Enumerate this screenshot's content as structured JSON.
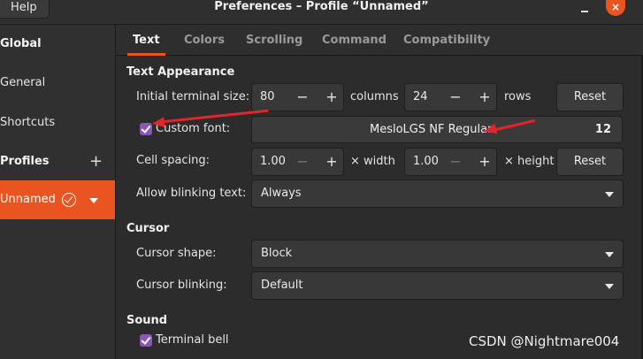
{
  "window": {
    "help_label": "Help",
    "title": "Preferences – Profile “Unnamed”",
    "close_glyph": "×"
  },
  "sidebar": {
    "global_heading": "Global",
    "items": [
      "General",
      "Shortcuts"
    ],
    "profiles_heading": "Profiles",
    "add_glyph": "+",
    "selected_profile": "Unnamed"
  },
  "tabs": [
    "Text",
    "Colors",
    "Scrolling",
    "Command",
    "Compatibility"
  ],
  "text_appearance": {
    "heading": "Text Appearance",
    "initial_size_label": "Initial terminal size:",
    "columns_value": "80",
    "columns_unit": "columns",
    "rows_value": "24",
    "rows_unit": "rows",
    "reset_label": "Reset",
    "custom_font_label": "Custom font:",
    "custom_font_checked": true,
    "font_name": "MesloLGS NF Regular",
    "font_size": "12",
    "cell_spacing_label": "Cell spacing:",
    "width_value": "1.00",
    "width_unit": "× width",
    "height_value": "1.00",
    "height_unit": "× height",
    "reset2_label": "Reset",
    "blink_label": "Allow blinking text:",
    "blink_value": "Always"
  },
  "cursor": {
    "heading": "Cursor",
    "shape_label": "Cursor shape:",
    "shape_value": "Block",
    "blinking_label": "Cursor blinking:",
    "blinking_value": "Default"
  },
  "sound": {
    "heading": "Sound",
    "bell_label": "Terminal bell",
    "bell_checked": true
  },
  "glyphs": {
    "minus": "−",
    "plus": "+"
  },
  "watermark": "CSDN @Nightmare004",
  "colors": {
    "accent": "#e95420",
    "checkbox": "#8a56b8",
    "annotation_arrow": "#e3242b"
  }
}
